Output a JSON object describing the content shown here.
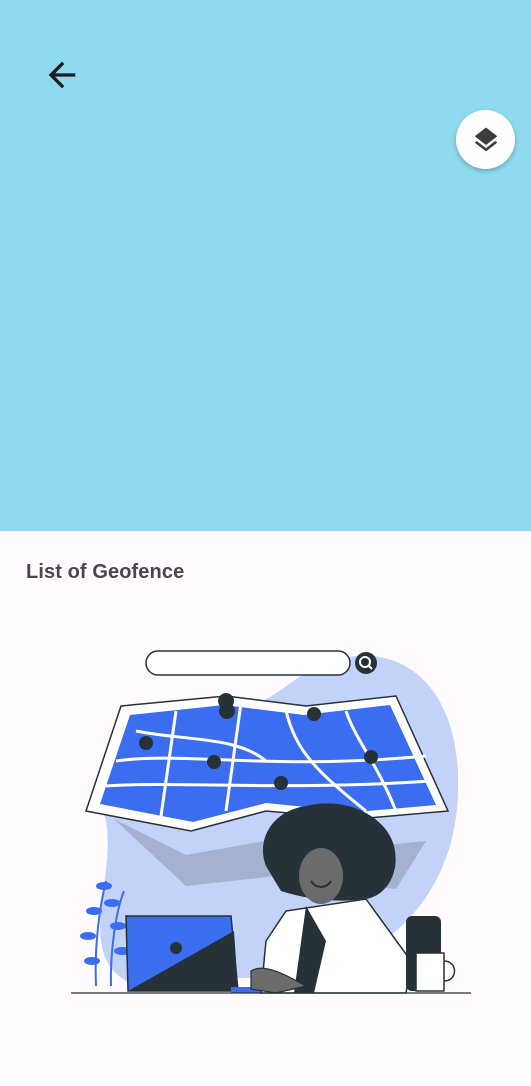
{
  "map": {
    "background_color": "#8fdaee",
    "back_icon": "arrow-left-icon",
    "layers_icon": "layers-icon"
  },
  "sheet": {
    "title": "List of Geofence",
    "illustration": "person-with-map-and-laptop-illustration"
  },
  "colors": {
    "accent_blue": "#3a6df0",
    "light_blue": "#c3d2f9",
    "dark": "#263238"
  }
}
